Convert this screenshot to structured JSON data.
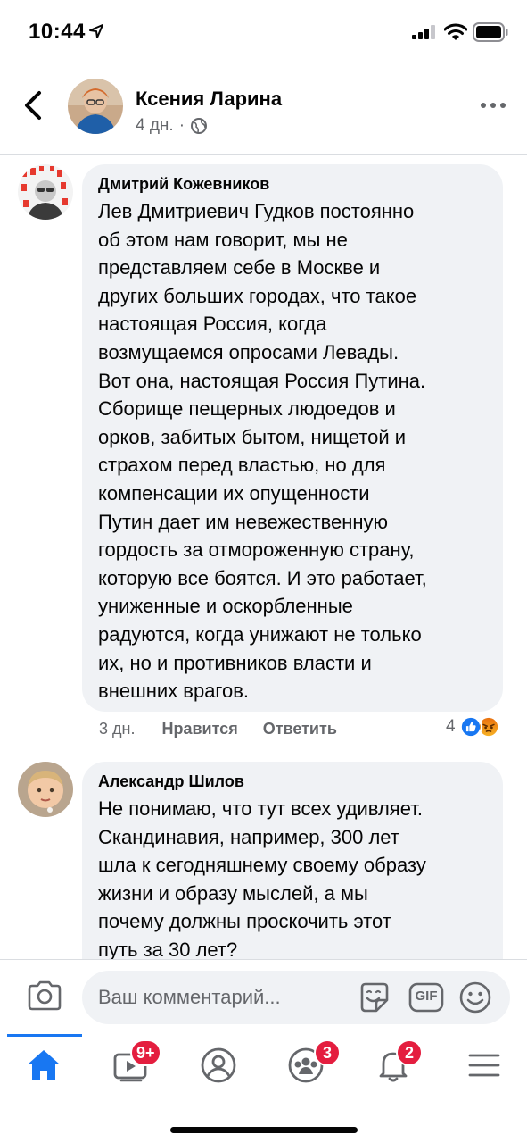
{
  "status_bar": {
    "time": "10:44"
  },
  "header": {
    "author": "Ксения Ларина",
    "time": "4 дн.",
    "separator": "·",
    "icons": {
      "back": "chevron-left-icon",
      "privacy": "globe-icon",
      "more": "more-horizontal-icon"
    }
  },
  "comments": [
    {
      "author": "Дмитрий Кожевников",
      "text": "Лев Дмитриевич Гудков постоянно\nоб этом нам говорит, мы не\nпредставляем себе в Москве и\nдругих больших городах, что такое\nнастоящая Россия, когда\nвозмущаемся опросами Левады.\nВот она, настоящая Россия Путина.\nСборище пещерных людоедов и\nорков, забитых бытом, нищетой и\nстрахом перед властью, но для\nкомпенсации их опущенности\nПутин дает им невежественную\nгордость за отмороженную страну,\nкоторую все боятся. И это работает,\nуниженные и оскорбленные\nрадуются, когда унижают не только\nих, но и противников власти и\nвнешних врагов.",
      "time": "3 дн.",
      "like_label": "Нравится",
      "reply_label": "Ответить",
      "reaction_count": "4",
      "reactions": [
        "like-reaction-icon",
        "angry-reaction-icon"
      ]
    },
    {
      "author": "Александр Шилов",
      "text": "Не понимаю, что тут всех удивляет.\nСкандинавия, например,  300 лет\nшла к сегодняшнему своему образу\nжизни и образу мыслей, а мы\nпочему должны проскочить этот\nпуть за 30 лет?"
    }
  ],
  "composer": {
    "placeholder": "Ваш комментарий...",
    "gif_label": "GIF"
  },
  "tabbar": {
    "tabs": [
      {
        "name": "home",
        "active": true
      },
      {
        "name": "watch",
        "badge": "9+"
      },
      {
        "name": "profile"
      },
      {
        "name": "groups",
        "badge": "3"
      },
      {
        "name": "notifications",
        "badge": "2"
      },
      {
        "name": "menu"
      }
    ]
  },
  "colors": {
    "accent": "#1877f2",
    "badge": "#e41e3f",
    "bubble": "#f0f2f5",
    "secondary_text": "#65676b"
  }
}
